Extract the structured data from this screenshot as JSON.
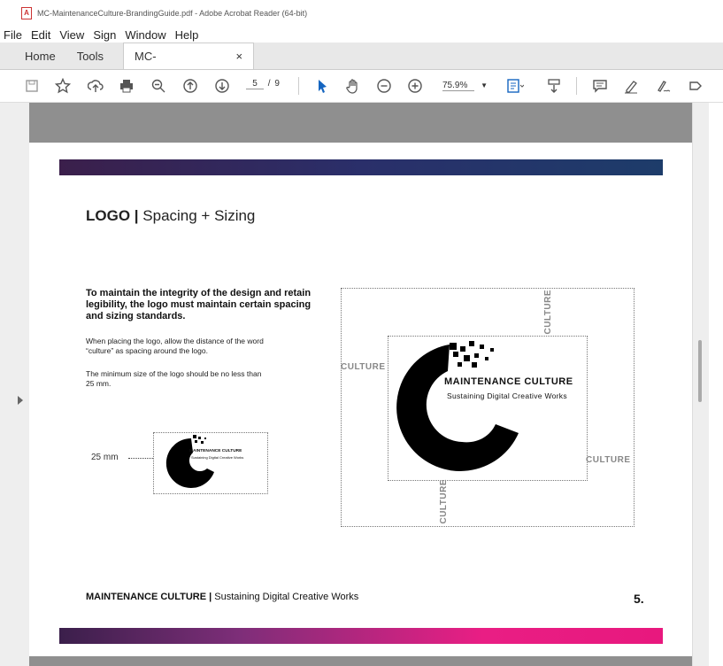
{
  "window": {
    "title": "MC-MaintenanceCulture-BrandingGuide.pdf - Adobe Acrobat Reader (64-bit)"
  },
  "menu": [
    "File",
    "Edit",
    "View",
    "Sign",
    "Window",
    "Help"
  ],
  "tabs": {
    "home": "Home",
    "tools": "Tools",
    "doc": "MC-MaintenanceC...",
    "close": "×"
  },
  "toolbar": {
    "page_current": "5",
    "page_sep": "/",
    "page_total": "9",
    "zoom": "75.9%"
  },
  "page": {
    "title_bold": "LOGO |",
    "title_rest": " Spacing + Sizing",
    "lead": "To maintain the integrity of the design and retain legibility, the logo must maintain certain spacing and sizing standards.",
    "para1": "When placing the logo, allow the distance of the word “culture” as spacing around the logo.",
    "para2": "The minimum size of the logo should be no less than 25 mm.",
    "min_size_label": "25 mm",
    "culture": "CULTURE",
    "logo_name": "MAINTENANCE CULTURE",
    "logo_tagline": "Sustaining Digital Creative Works",
    "footer_bold": "MAINTENANCE CULTURE |",
    "footer_rest": " Sustaining Digital Creative Works",
    "page_number": "5."
  },
  "colors": {
    "topbar_start": "#3b1f4b",
    "topbar_end": "#1d3c6a",
    "bottombar_end": "#e8187e",
    "viewer_bg": "#8f8f8f"
  },
  "icons": [
    "save-icon",
    "star-icon",
    "upload-icon",
    "print-icon",
    "zoom-out-search-icon",
    "page-up-icon",
    "page-down-icon",
    "select-cursor-icon",
    "hand-icon",
    "zoom-out-icon",
    "zoom-in-icon",
    "fit-page-icon",
    "scroll-mode-icon",
    "comment-icon",
    "highlight-icon",
    "sign-icon",
    "edit-icon"
  ]
}
